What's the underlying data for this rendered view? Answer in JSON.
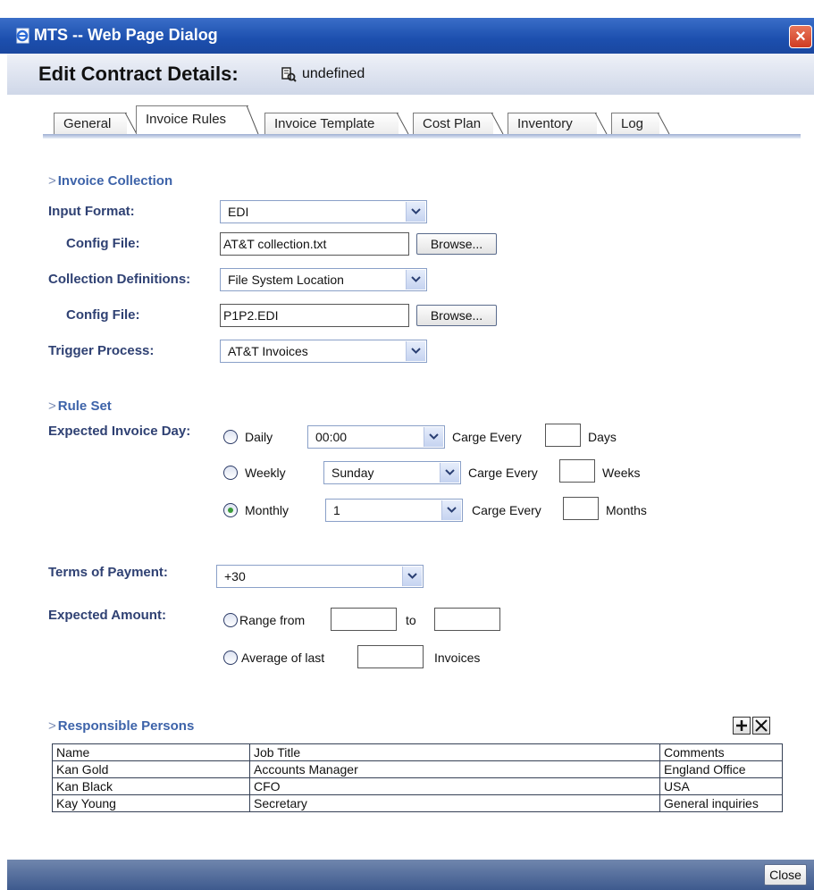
{
  "window": {
    "title": "MTS -- Web Page Dialog",
    "close_glyph": "×"
  },
  "header": {
    "title": "Edit Contract Details:",
    "subtitle": "undefined"
  },
  "tabs": [
    "General",
    "Invoice Rules",
    "Invoice Template",
    "Cost Plan",
    "Inventory",
    "Log"
  ],
  "active_tab": "Invoice Rules",
  "invoice_collection": {
    "section": "Invoice Collection",
    "input_format_label": "Input Format:",
    "input_format_value": "EDI",
    "config_file_label": "Config File:",
    "config_file_1": "AT&T collection.txt",
    "browse_label": "Browse...",
    "collection_definitions_label": "Collection Definitions:",
    "collection_definitions_value": "File System Location",
    "config_file_2": "P1P2.EDI",
    "trigger_process_label": "Trigger Process:",
    "trigger_process_value": "AT&T Invoices"
  },
  "rule_set": {
    "section": "Rule Set",
    "expected_day_label": "Expected Invoice Day:",
    "charge_every": "Carge Every",
    "daily": {
      "label": "Daily",
      "value": "00:00",
      "unit": "Days"
    },
    "weekly": {
      "label": "Weekly",
      "value": "Sunday",
      "unit": "Weeks"
    },
    "monthly": {
      "label": "Monthly",
      "value": "1",
      "unit": "Months"
    },
    "selected": "Monthly",
    "terms_label": "Terms of Payment:",
    "terms_value": "+30",
    "amount_label": "Expected Amount:",
    "range_from": "Range from",
    "to": "to",
    "average_of_last": "Average of last",
    "invoices": "Invoices"
  },
  "responsible_persons": {
    "section": "Responsible Persons",
    "columns": [
      "Name",
      "Job Title",
      "Comments"
    ],
    "rows": [
      [
        "Kan Gold",
        "Accounts Manager",
        "England Office"
      ],
      [
        "Kan Black",
        "CFO",
        "USA"
      ],
      [
        "Kay Young",
        "Secretary",
        "General inquiries"
      ]
    ]
  },
  "footer": {
    "close_label": "Close"
  },
  "colors": {
    "titlebar": "#1c4fae",
    "label": "#2f4173",
    "section": "#3d63a9",
    "footer": "#3e5a8e"
  }
}
